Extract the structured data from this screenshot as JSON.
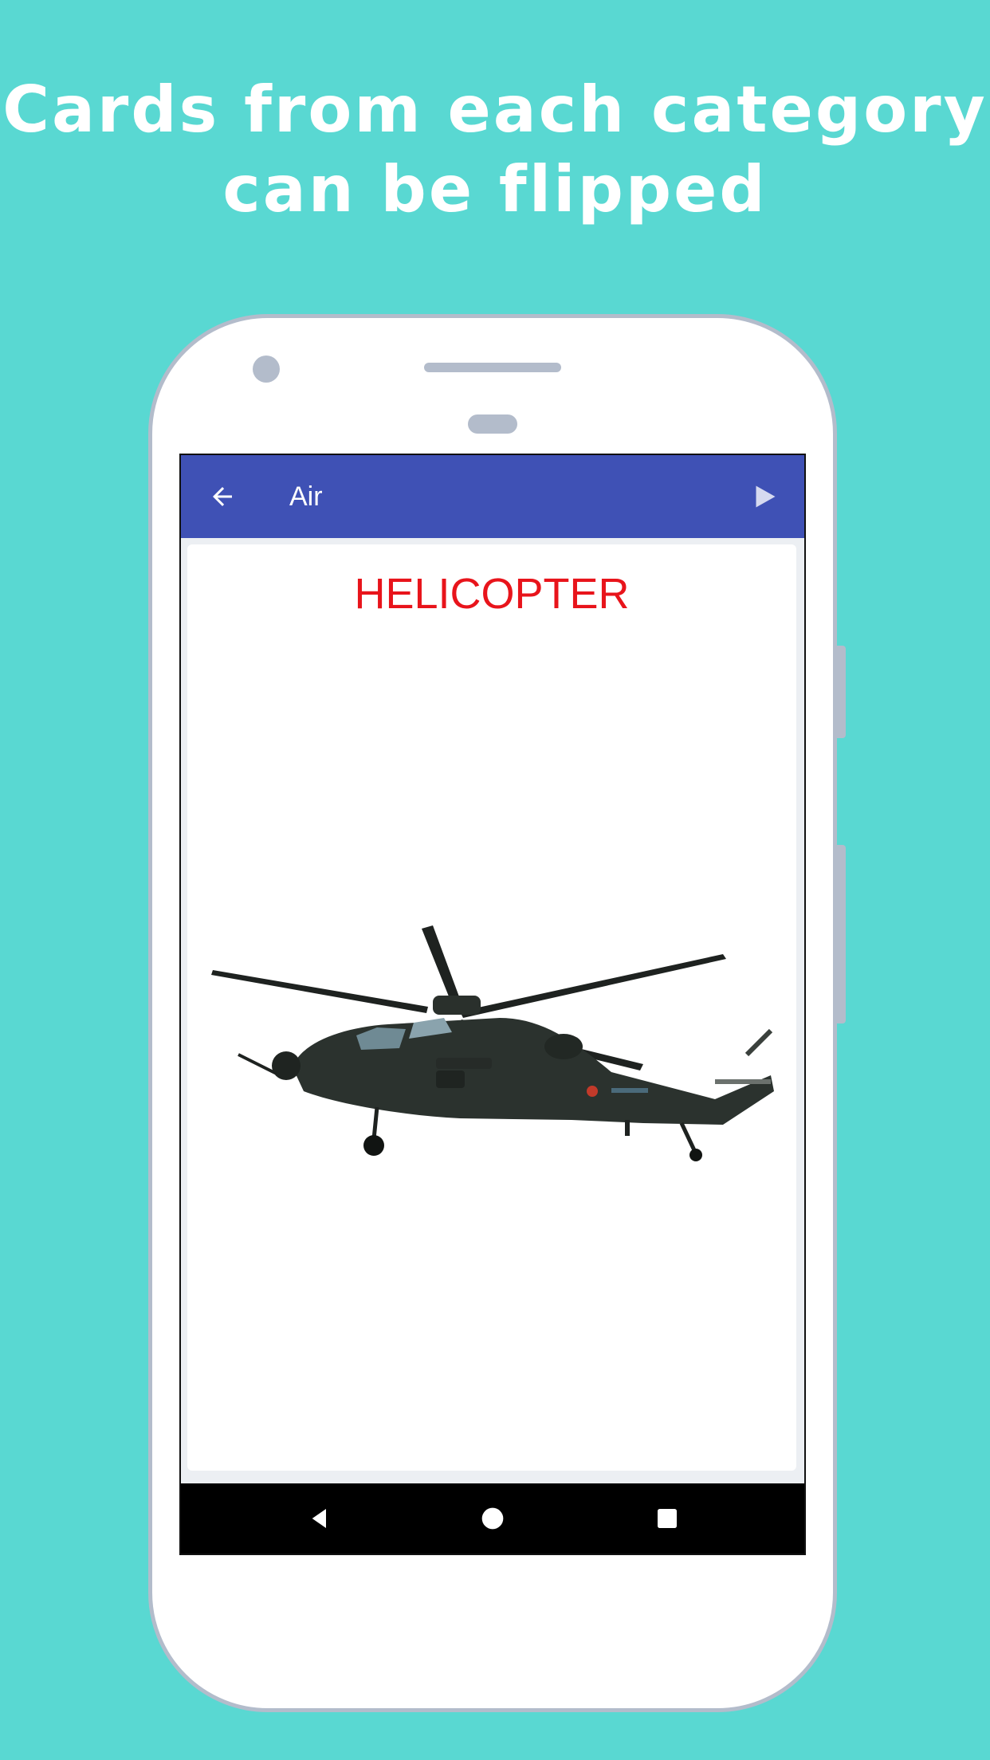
{
  "headline": {
    "line1": "Cards from each category",
    "line2": "can be flipped"
  },
  "app": {
    "title": "Air",
    "back_icon": "arrow-left-icon",
    "play_icon": "play-icon",
    "appbar_color": "#3f51b5"
  },
  "card": {
    "word": "HELICOPTER",
    "word_color": "#e8141b",
    "image": "helicopter-illustration"
  },
  "navigation": {
    "back": "nav-back-icon",
    "home": "nav-home-icon",
    "recents": "nav-recents-icon"
  },
  "colors": {
    "background": "#59d8d2",
    "phone_frame": "#b3bccb"
  }
}
